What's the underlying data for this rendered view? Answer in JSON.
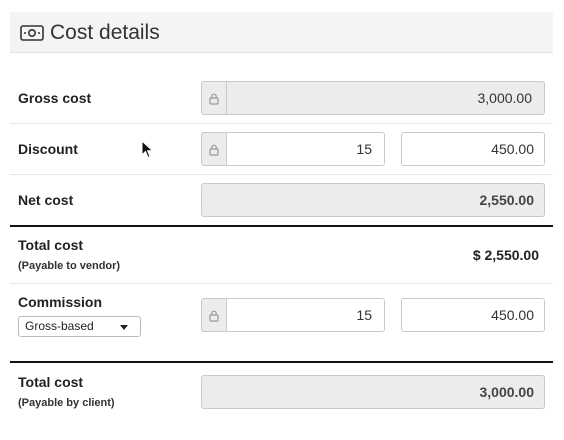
{
  "header": {
    "title": "Cost details",
    "icon": "money-icon"
  },
  "gross_cost": {
    "label": "Gross cost",
    "value": "3,000.00"
  },
  "discount": {
    "label": "Discount",
    "percent": "15",
    "amount": "450.00"
  },
  "net_cost": {
    "label": "Net cost",
    "value": "2,550.00"
  },
  "total_vendor": {
    "label": "Total cost",
    "sublabel": "(Payable to vendor)",
    "value": "$ 2,550.00"
  },
  "commission": {
    "label": "Commission",
    "basis": "Gross-based",
    "percent": "15",
    "amount": "450.00"
  },
  "total_client": {
    "label": "Total cost",
    "sublabel": "(Payable by client)",
    "value": "3,000.00"
  }
}
